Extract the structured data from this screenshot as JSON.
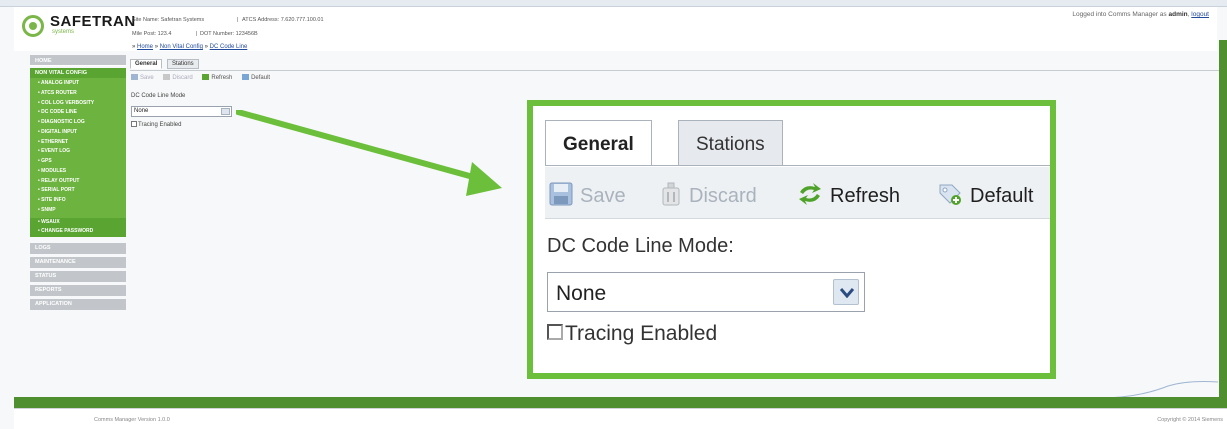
{
  "header": {
    "logo_name": "SAFETRAN",
    "logo_sub": "systems",
    "site_name": "Site Name: Safetran Systems",
    "atcs_address": "ATCS Address: 7.620.777.100.01",
    "mile_post": "Mile Post:  123.4",
    "dot_number": "DOT Number:  123456B",
    "login_prefix": "Logged into Comms Manager as",
    "login_user": "admin",
    "logout_label": "logout"
  },
  "breadcrumb": {
    "home": "Home",
    "non_vital_config": "Non Vital Config",
    "current": "DC Code Line",
    "separator": "»"
  },
  "sidebar": {
    "home_label": "HOME",
    "section_label": "NON VITAL CONFIG",
    "items": [
      "ANALOG INPUT",
      "ATCS ROUTER",
      "COL LOG VERBOSITY",
      "DC CODE LINE",
      "DIAGNOSTIC LOG",
      "DIGITAL INPUT",
      "ETHERNET",
      "EVENT LOG",
      "GPS",
      "MODULES",
      "RELAY OUTPUT",
      "SERIAL PORT",
      "SITE INFO",
      "SNMP"
    ],
    "sub_items": [
      "WSAUX",
      "CHANGE PASSWORD"
    ],
    "bottom_items": [
      "LOGS",
      "MAINTENANCE",
      "STATUS",
      "REPORTS",
      "APPLICATION"
    ]
  },
  "tabs": {
    "general": "General",
    "stations": "Stations"
  },
  "toolbar": {
    "save": "Save",
    "discard": "Discard",
    "refresh": "Refresh",
    "default": "Default"
  },
  "form": {
    "mode_label": "DC Code Line Mode:",
    "mode_label_small": "DC Code Line Mode",
    "mode_value": "None",
    "tracing_label": "Tracing Enabled"
  },
  "footer": {
    "version": "Comms Manager Version 1.0.0",
    "copyright": "Copyright © 2014 Siemens"
  },
  "colors": {
    "brand_green": "#6bbf3a",
    "sidebar_green": "#6db33f",
    "link_blue": "#224c9b"
  }
}
